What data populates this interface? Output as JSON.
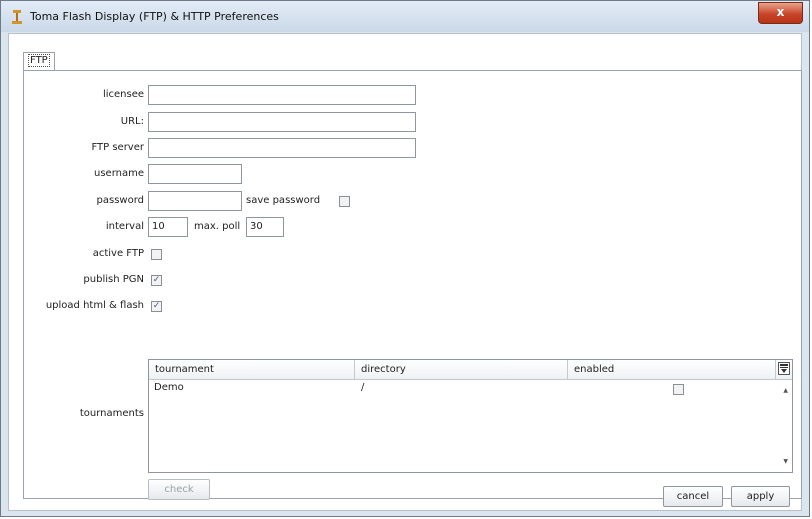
{
  "window": {
    "title": "Toma Flash Display (FTP) & HTTP Preferences",
    "close_label": "x"
  },
  "tabs": [
    {
      "label": "FTP",
      "selected": true
    }
  ],
  "form": {
    "licensee_label": "licensee",
    "licensee_value": "",
    "url_label": "URL:",
    "url_value": "",
    "ftp_server_label": "FTP server",
    "ftp_server_value": "",
    "username_label": "username",
    "username_value": "",
    "password_label": "password",
    "password_value": "",
    "save_password_label": "save password",
    "save_password_checked": false,
    "interval_label": "interval",
    "interval_value": "10",
    "max_poll_label": "max. poll",
    "max_poll_value": "30",
    "active_ftp_label": "active FTP",
    "active_ftp_checked": false,
    "publish_pgn_label": "publish PGN",
    "publish_pgn_checked": true,
    "upload_label": "upload html & flash",
    "upload_checked": true
  },
  "tournaments": {
    "label": "tournaments",
    "columns": [
      "tournament",
      "directory",
      "enabled"
    ],
    "rows": [
      {
        "tournament": "Demo",
        "directory": "/",
        "enabled": false
      }
    ],
    "check_label": "check"
  },
  "footer": {
    "cancel_label": "cancel",
    "apply_label": "apply"
  },
  "colors": {
    "window_frame": "#dbe5ef",
    "close_button": "#c9452a",
    "checkbox_mark": "#4a5a8a"
  },
  "icons": {
    "app_icon": "app-icon",
    "column_chooser": "column-chooser-icon",
    "checkmark": "checkmark-icon"
  }
}
